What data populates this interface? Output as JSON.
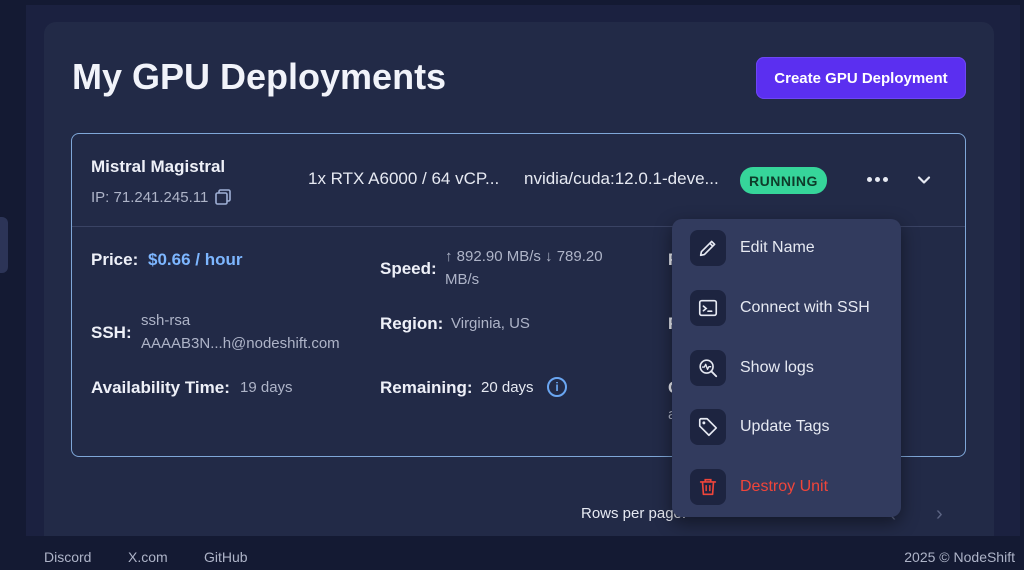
{
  "page": {
    "title": "My GPU Deployments",
    "create_button": "Create GPU Deployment"
  },
  "deployment": {
    "name": "Mistral Magistral",
    "ip_label": "IP: 71.241.245.11",
    "spec": "1x RTX A6000 / 64 vCP...",
    "image": "nvidia/cuda:12.0.1-deve...",
    "status": "RUNNING",
    "details": {
      "price_label": "Price:",
      "price_value": "$0.66 / hour",
      "speed_label": "Speed:",
      "speed_value_line1": "↑ 892.90 MB/s ↓ 789.20",
      "speed_value_line2": "MB/s",
      "ssh_label": "SSH:",
      "ssh_value_line1": "ssh-rsa",
      "ssh_value_line2": "AAAAB3N...h@nodeshift.com",
      "region_label": "Region:",
      "region_value": "Virginia, US",
      "availability_label": "Availability Time:",
      "availability_value": "19 days",
      "remaining_label": "Remaining:",
      "remaining_value": "20 days",
      "partial_f1": "F",
      "partial_f2": "F",
      "partial_c": "C",
      "partial_a": "a"
    }
  },
  "menu": {
    "items": [
      {
        "label": "Edit Name",
        "icon": "pencil-icon"
      },
      {
        "label": "Connect with SSH",
        "icon": "terminal-icon"
      },
      {
        "label": "Show logs",
        "icon": "logs-search-icon"
      },
      {
        "label": "Update Tags",
        "icon": "tag-icon"
      },
      {
        "label": "Destroy Unit",
        "icon": "trash-icon"
      }
    ]
  },
  "pagination": {
    "rows_label": "Rows per page:",
    "prev": "‹",
    "next": "›"
  },
  "footer": {
    "links": [
      "Discord",
      "X.com",
      "GitHub"
    ],
    "copyright": "2025 © NodeShift"
  },
  "colors": {
    "accent": "#5b2ff0",
    "running": "#36d59a",
    "price": "#7db6ff",
    "danger": "#f0453a"
  }
}
